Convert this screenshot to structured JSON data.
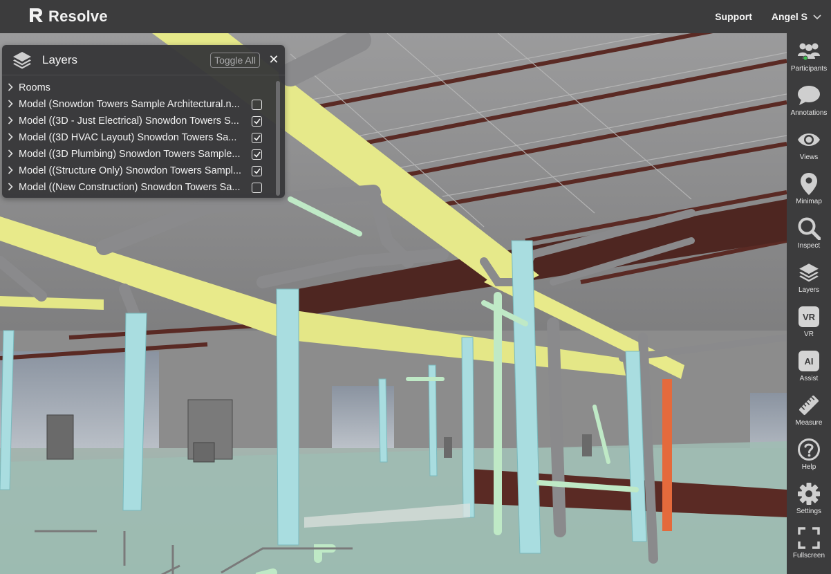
{
  "header": {
    "brand": "Resolve",
    "support": "Support",
    "user": "Angel S"
  },
  "layers_panel": {
    "title": "Layers",
    "toggle_all": "Toggle All",
    "items": [
      {
        "label": "Rooms",
        "checkbox": false,
        "checked": false
      },
      {
        "label": "Model (Snowdon Towers Sample Architectural.n...",
        "checkbox": true,
        "checked": false
      },
      {
        "label": "Model ((3D - Just Electrical) Snowdon Towers S...",
        "checkbox": true,
        "checked": true
      },
      {
        "label": "Model ((3D HVAC Layout) Snowdon Towers Sa...",
        "checkbox": true,
        "checked": true
      },
      {
        "label": "Model ((3D Plumbing) Snowdon Towers Sample...",
        "checkbox": true,
        "checked": true
      },
      {
        "label": "Model ((Structure Only) Snowdon Towers Sampl...",
        "checkbox": true,
        "checked": true
      },
      {
        "label": "Model ((New Construction) Snowdon Towers Sa...",
        "checkbox": true,
        "checked": false
      }
    ]
  },
  "rail": {
    "items": [
      {
        "label": "Participants",
        "icon": "participants-icon"
      },
      {
        "label": "Annotations",
        "icon": "speech-bubble-icon"
      },
      {
        "label": "Views",
        "icon": "eye-icon"
      },
      {
        "label": "Minimap",
        "icon": "map-pin-icon"
      },
      {
        "label": "Inspect",
        "icon": "magnifier-icon"
      },
      {
        "label": "Layers",
        "icon": "layers-icon"
      },
      {
        "label": "VR",
        "icon": "vr-icon",
        "tag": "VR"
      },
      {
        "label": "Assist",
        "icon": "ai-icon",
        "tag": "AI"
      },
      {
        "label": "Measure",
        "icon": "ruler-icon"
      },
      {
        "label": "Help",
        "icon": "help-icon"
      },
      {
        "label": "Settings",
        "icon": "gear-icon"
      },
      {
        "label": "Fullscreen",
        "icon": "fullscreen-icon"
      }
    ]
  },
  "colors": {
    "chrome": "#3c3c3d",
    "beam_yellow": "#e8ea8a",
    "column_cyan": "#a9dde0",
    "pipe_green": "#bfe9c6",
    "joist_red": "#5a2a24",
    "duct_gray": "#8d8d8f",
    "floor_teal": "#9fb7b0",
    "accent_orange": "#e46a3c"
  }
}
